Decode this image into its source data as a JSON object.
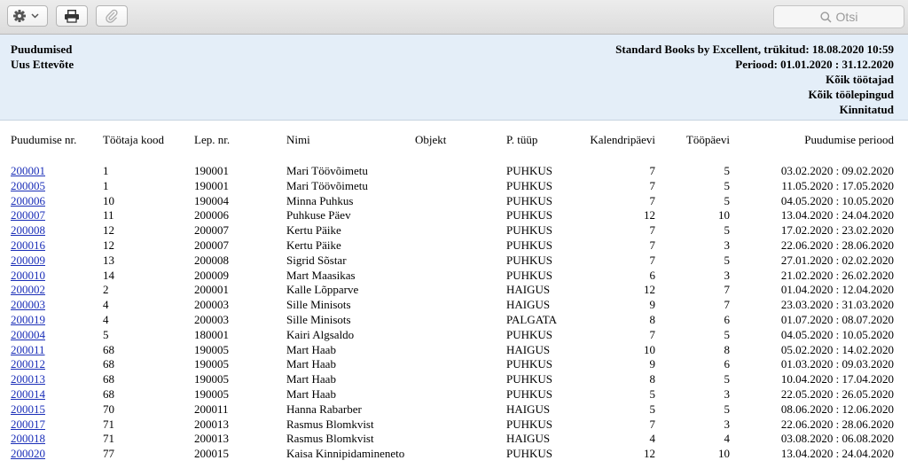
{
  "toolbar": {
    "settings_icon": "gear-icon",
    "print_icon": "printer-icon",
    "attach_icon": "paperclip-icon",
    "search_placeholder": "Otsi"
  },
  "report": {
    "title": "Puudumised",
    "subtitle": "Uus Ettevõte",
    "meta_lines": [
      "Standard Books by Excellent, trükitud: 18.08.2020 10:59",
      "Periood: 01.01.2020 : 31.12.2020",
      "Kõik töötajad",
      "Kõik töölepingud",
      "Kinnitatud"
    ]
  },
  "columns": {
    "nr": "Puudumise nr.",
    "code": "Töötaja kood",
    "lep": "Lep. nr.",
    "name": "Nimi",
    "obj": "Objekt",
    "type": "P. tüüp",
    "cal": "Kalendripäevi",
    "work": "Tööpäevi",
    "period": "Puudumise periood"
  },
  "rows": [
    {
      "nr": "200001",
      "code": "1",
      "lep": "190001",
      "name": "Mari Töövõimetu",
      "obj": "",
      "type": "PUHKUS",
      "cal": "7",
      "work": "5",
      "period": "03.02.2020 : 09.02.2020"
    },
    {
      "nr": "200005",
      "code": "1",
      "lep": "190001",
      "name": "Mari Töövõimetu",
      "obj": "",
      "type": "PUHKUS",
      "cal": "7",
      "work": "5",
      "period": "11.05.2020 : 17.05.2020"
    },
    {
      "nr": "200006",
      "code": "10",
      "lep": "190004",
      "name": "Minna Puhkus",
      "obj": "",
      "type": "PUHKUS",
      "cal": "7",
      "work": "5",
      "period": "04.05.2020 : 10.05.2020"
    },
    {
      "nr": "200007",
      "code": "11",
      "lep": "200006",
      "name": "Puhkuse Päev",
      "obj": "",
      "type": "PUHKUS",
      "cal": "12",
      "work": "10",
      "period": "13.04.2020 : 24.04.2020"
    },
    {
      "nr": "200008",
      "code": "12",
      "lep": "200007",
      "name": "Kertu Päike",
      "obj": "",
      "type": "PUHKUS",
      "cal": "7",
      "work": "5",
      "period": "17.02.2020 : 23.02.2020"
    },
    {
      "nr": "200016",
      "code": "12",
      "lep": "200007",
      "name": "Kertu Päike",
      "obj": "",
      "type": "PUHKUS",
      "cal": "7",
      "work": "3",
      "period": "22.06.2020 : 28.06.2020"
    },
    {
      "nr": "200009",
      "code": "13",
      "lep": "200008",
      "name": "Sigrid Sõstar",
      "obj": "",
      "type": "PUHKUS",
      "cal": "7",
      "work": "5",
      "period": "27.01.2020 : 02.02.2020"
    },
    {
      "nr": "200010",
      "code": "14",
      "lep": "200009",
      "name": "Mart Maasikas",
      "obj": "",
      "type": "PUHKUS",
      "cal": "6",
      "work": "3",
      "period": "21.02.2020 : 26.02.2020"
    },
    {
      "nr": "200002",
      "code": "2",
      "lep": "200001",
      "name": "Kalle Lõpparve",
      "obj": "",
      "type": "HAIGUS",
      "cal": "12",
      "work": "7",
      "period": "01.04.2020 : 12.04.2020"
    },
    {
      "nr": "200003",
      "code": "4",
      "lep": "200003",
      "name": "Sille Minisots",
      "obj": "",
      "type": "HAIGUS",
      "cal": "9",
      "work": "7",
      "period": "23.03.2020 : 31.03.2020"
    },
    {
      "nr": "200019",
      "code": "4",
      "lep": "200003",
      "name": "Sille Minisots",
      "obj": "",
      "type": "PALGATA",
      "cal": "8",
      "work": "6",
      "period": "01.07.2020 : 08.07.2020"
    },
    {
      "nr": "200004",
      "code": "5",
      "lep": "180001",
      "name": "Kairi Algsaldo",
      "obj": "",
      "type": "PUHKUS",
      "cal": "7",
      "work": "5",
      "period": "04.05.2020 : 10.05.2020"
    },
    {
      "nr": "200011",
      "code": "68",
      "lep": "190005",
      "name": "Mart Haab",
      "obj": "",
      "type": "HAIGUS",
      "cal": "10",
      "work": "8",
      "period": "05.02.2020 : 14.02.2020"
    },
    {
      "nr": "200012",
      "code": "68",
      "lep": "190005",
      "name": "Mart Haab",
      "obj": "",
      "type": "PUHKUS",
      "cal": "9",
      "work": "6",
      "period": "01.03.2020 : 09.03.2020"
    },
    {
      "nr": "200013",
      "code": "68",
      "lep": "190005",
      "name": "Mart Haab",
      "obj": "",
      "type": "PUHKUS",
      "cal": "8",
      "work": "5",
      "period": "10.04.2020 : 17.04.2020"
    },
    {
      "nr": "200014",
      "code": "68",
      "lep": "190005",
      "name": "Mart Haab",
      "obj": "",
      "type": "PUHKUS",
      "cal": "5",
      "work": "3",
      "period": "22.05.2020 : 26.05.2020"
    },
    {
      "nr": "200015",
      "code": "70",
      "lep": "200011",
      "name": "Hanna Rabarber",
      "obj": "",
      "type": "HAIGUS",
      "cal": "5",
      "work": "5",
      "period": "08.06.2020 : 12.06.2020"
    },
    {
      "nr": "200017",
      "code": "71",
      "lep": "200013",
      "name": "Rasmus Blomkvist",
      "obj": "",
      "type": "PUHKUS",
      "cal": "7",
      "work": "3",
      "period": "22.06.2020 : 28.06.2020"
    },
    {
      "nr": "200018",
      "code": "71",
      "lep": "200013",
      "name": "Rasmus Blomkvist",
      "obj": "",
      "type": "HAIGUS",
      "cal": "4",
      "work": "4",
      "period": "03.08.2020 : 06.08.2020"
    },
    {
      "nr": "200020",
      "code": "77",
      "lep": "200015",
      "name": "Kaisa Kinnipidamineneto",
      "obj": "",
      "type": "PUHKUS",
      "cal": "12",
      "work": "10",
      "period": "13.04.2020 : 24.04.2020"
    }
  ]
}
